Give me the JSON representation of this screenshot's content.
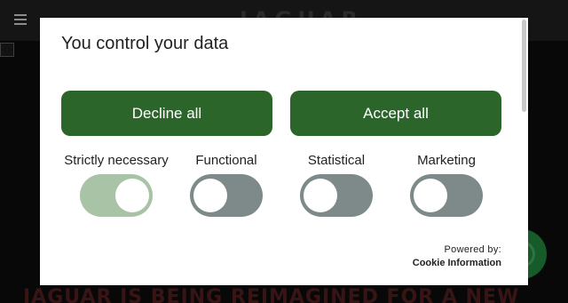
{
  "background": {
    "logo_text": "JAGUAR",
    "headline": "JAGUAR IS BEING REIMAGINED FOR A NEW"
  },
  "modal": {
    "title": "You control your data",
    "decline_label": "Decline all",
    "accept_label": "Accept all",
    "toggles": [
      {
        "label": "Strictly necessary",
        "enabled": true
      },
      {
        "label": "Functional",
        "enabled": false
      },
      {
        "label": "Statistical",
        "enabled": false
      },
      {
        "label": "Marketing",
        "enabled": false
      }
    ],
    "powered_by": "Powered by:",
    "provider": "Cookie Information"
  },
  "colors": {
    "button_green": "#2c652a",
    "toggle_on": "#a8c3a6",
    "toggle_off": "#7d8a89",
    "chat_green": "#1f7a3a"
  },
  "icons": [
    "menu-icon",
    "broken-image-icon",
    "chat-icon"
  ]
}
